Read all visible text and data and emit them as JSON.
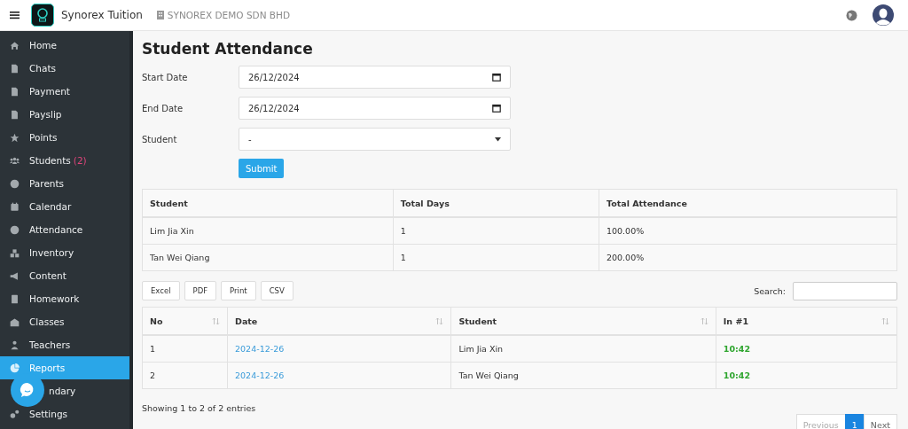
{
  "header": {
    "app_name": "Synorex Tuition",
    "company": "SYNOREX DEMO SDN BHD"
  },
  "sidebar": {
    "items": [
      {
        "label": "Home",
        "selected": false
      },
      {
        "label": "Chats",
        "selected": false
      },
      {
        "label": "Payment",
        "selected": false
      },
      {
        "label": "Payslip",
        "selected": false
      },
      {
        "label": "Points",
        "selected": false
      },
      {
        "label": "Students",
        "badge": "(2)",
        "selected": false
      },
      {
        "label": "Parents",
        "selected": false
      },
      {
        "label": "Calendar",
        "selected": false
      },
      {
        "label": "Attendance",
        "selected": false
      },
      {
        "label": "Inventory",
        "selected": false
      },
      {
        "label": "Content",
        "selected": false
      },
      {
        "label": "Homework",
        "selected": false
      },
      {
        "label": "Classes",
        "selected": false
      },
      {
        "label": "Teachers",
        "selected": false
      },
      {
        "label": "Reports",
        "selected": true
      },
      {
        "label": "ndary",
        "selected": false
      },
      {
        "label": "Settings",
        "selected": false
      }
    ]
  },
  "page": {
    "title": "Student Attendance",
    "form": {
      "start_date": {
        "label": "Start Date",
        "value": "26/12/2024"
      },
      "end_date": {
        "label": "End Date",
        "value": "26/12/2024"
      },
      "student": {
        "label": "Student",
        "value": "-"
      },
      "submit": "Submit"
    },
    "summary_table": {
      "columns": [
        "Student",
        "Total Days",
        "Total Attendance"
      ],
      "rows": [
        [
          "Lim Jia Xin",
          "1",
          "100.00%"
        ],
        [
          "Tan Wei Qiang",
          "1",
          "200.00%"
        ]
      ]
    },
    "export_buttons": [
      "Excel",
      "PDF",
      "Print",
      "CSV"
    ],
    "search_label": "Search:",
    "detail_table": {
      "columns": [
        "No",
        "Date",
        "Student",
        "In #1"
      ],
      "rows": [
        [
          "1",
          "2024-12-26",
          "Lim Jia Xin",
          "10:42"
        ],
        [
          "2",
          "2024-12-26",
          "Tan Wei Qiang",
          "10:42"
        ]
      ]
    },
    "info": "Showing 1 to 2 of 2 entries",
    "pagination": {
      "previous": {
        "label": "Previous",
        "disabled": true
      },
      "pages": [
        {
          "label": "1",
          "selected": true
        }
      ],
      "next": {
        "label": "Next",
        "disabled": false
      }
    }
  }
}
